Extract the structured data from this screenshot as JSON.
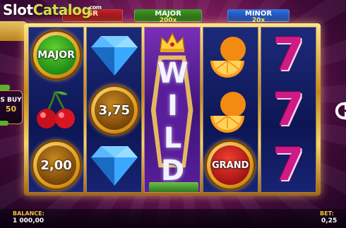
{
  "watermark": {
    "part1": "Slot",
    "part2": "Catalog",
    "suffix": ".com"
  },
  "jackpots": {
    "grand": {
      "name": "GR",
      "multiplier": ""
    },
    "major": {
      "name": "MAJOR",
      "multiplier": "200x"
    },
    "minor": {
      "name": "MINOR",
      "multiplier": "20x"
    }
  },
  "buy_feature": {
    "line1": "S BUY",
    "line2": "50"
  },
  "reels": [
    {
      "symbols": [
        {
          "type": "coin-major",
          "label": "MAJOR"
        },
        {
          "type": "cherries",
          "label": ""
        },
        {
          "type": "coin-value",
          "label": "2,00"
        }
      ]
    },
    {
      "symbols": [
        {
          "type": "diamond",
          "label": ""
        },
        {
          "type": "coin-value",
          "label": "3,75"
        },
        {
          "type": "diamond",
          "label": ""
        }
      ]
    },
    {
      "symbols": [
        {
          "type": "wild",
          "label": "WILD"
        }
      ]
    },
    {
      "symbols": [
        {
          "type": "orange",
          "label": ""
        },
        {
          "type": "orange",
          "label": ""
        },
        {
          "type": "coin-grand",
          "label": "GRAND"
        }
      ]
    },
    {
      "symbols": [
        {
          "type": "seven",
          "label": "7"
        },
        {
          "type": "seven",
          "label": "7"
        },
        {
          "type": "seven",
          "label": "7"
        }
      ]
    }
  ],
  "footer": {
    "balance_label": "BALANCE:",
    "balance_value": "1 000,00",
    "bet_label": "BET:",
    "bet_value": "0,25"
  },
  "icons": {
    "spin": "refresh-arrow-icon",
    "crown": "crown-icon"
  },
  "colors": {
    "grand": "#c8202a",
    "major": "#3f9a23",
    "minor": "#2d6fe0",
    "gold": "#f1c23b",
    "seven": "#d01a86"
  }
}
